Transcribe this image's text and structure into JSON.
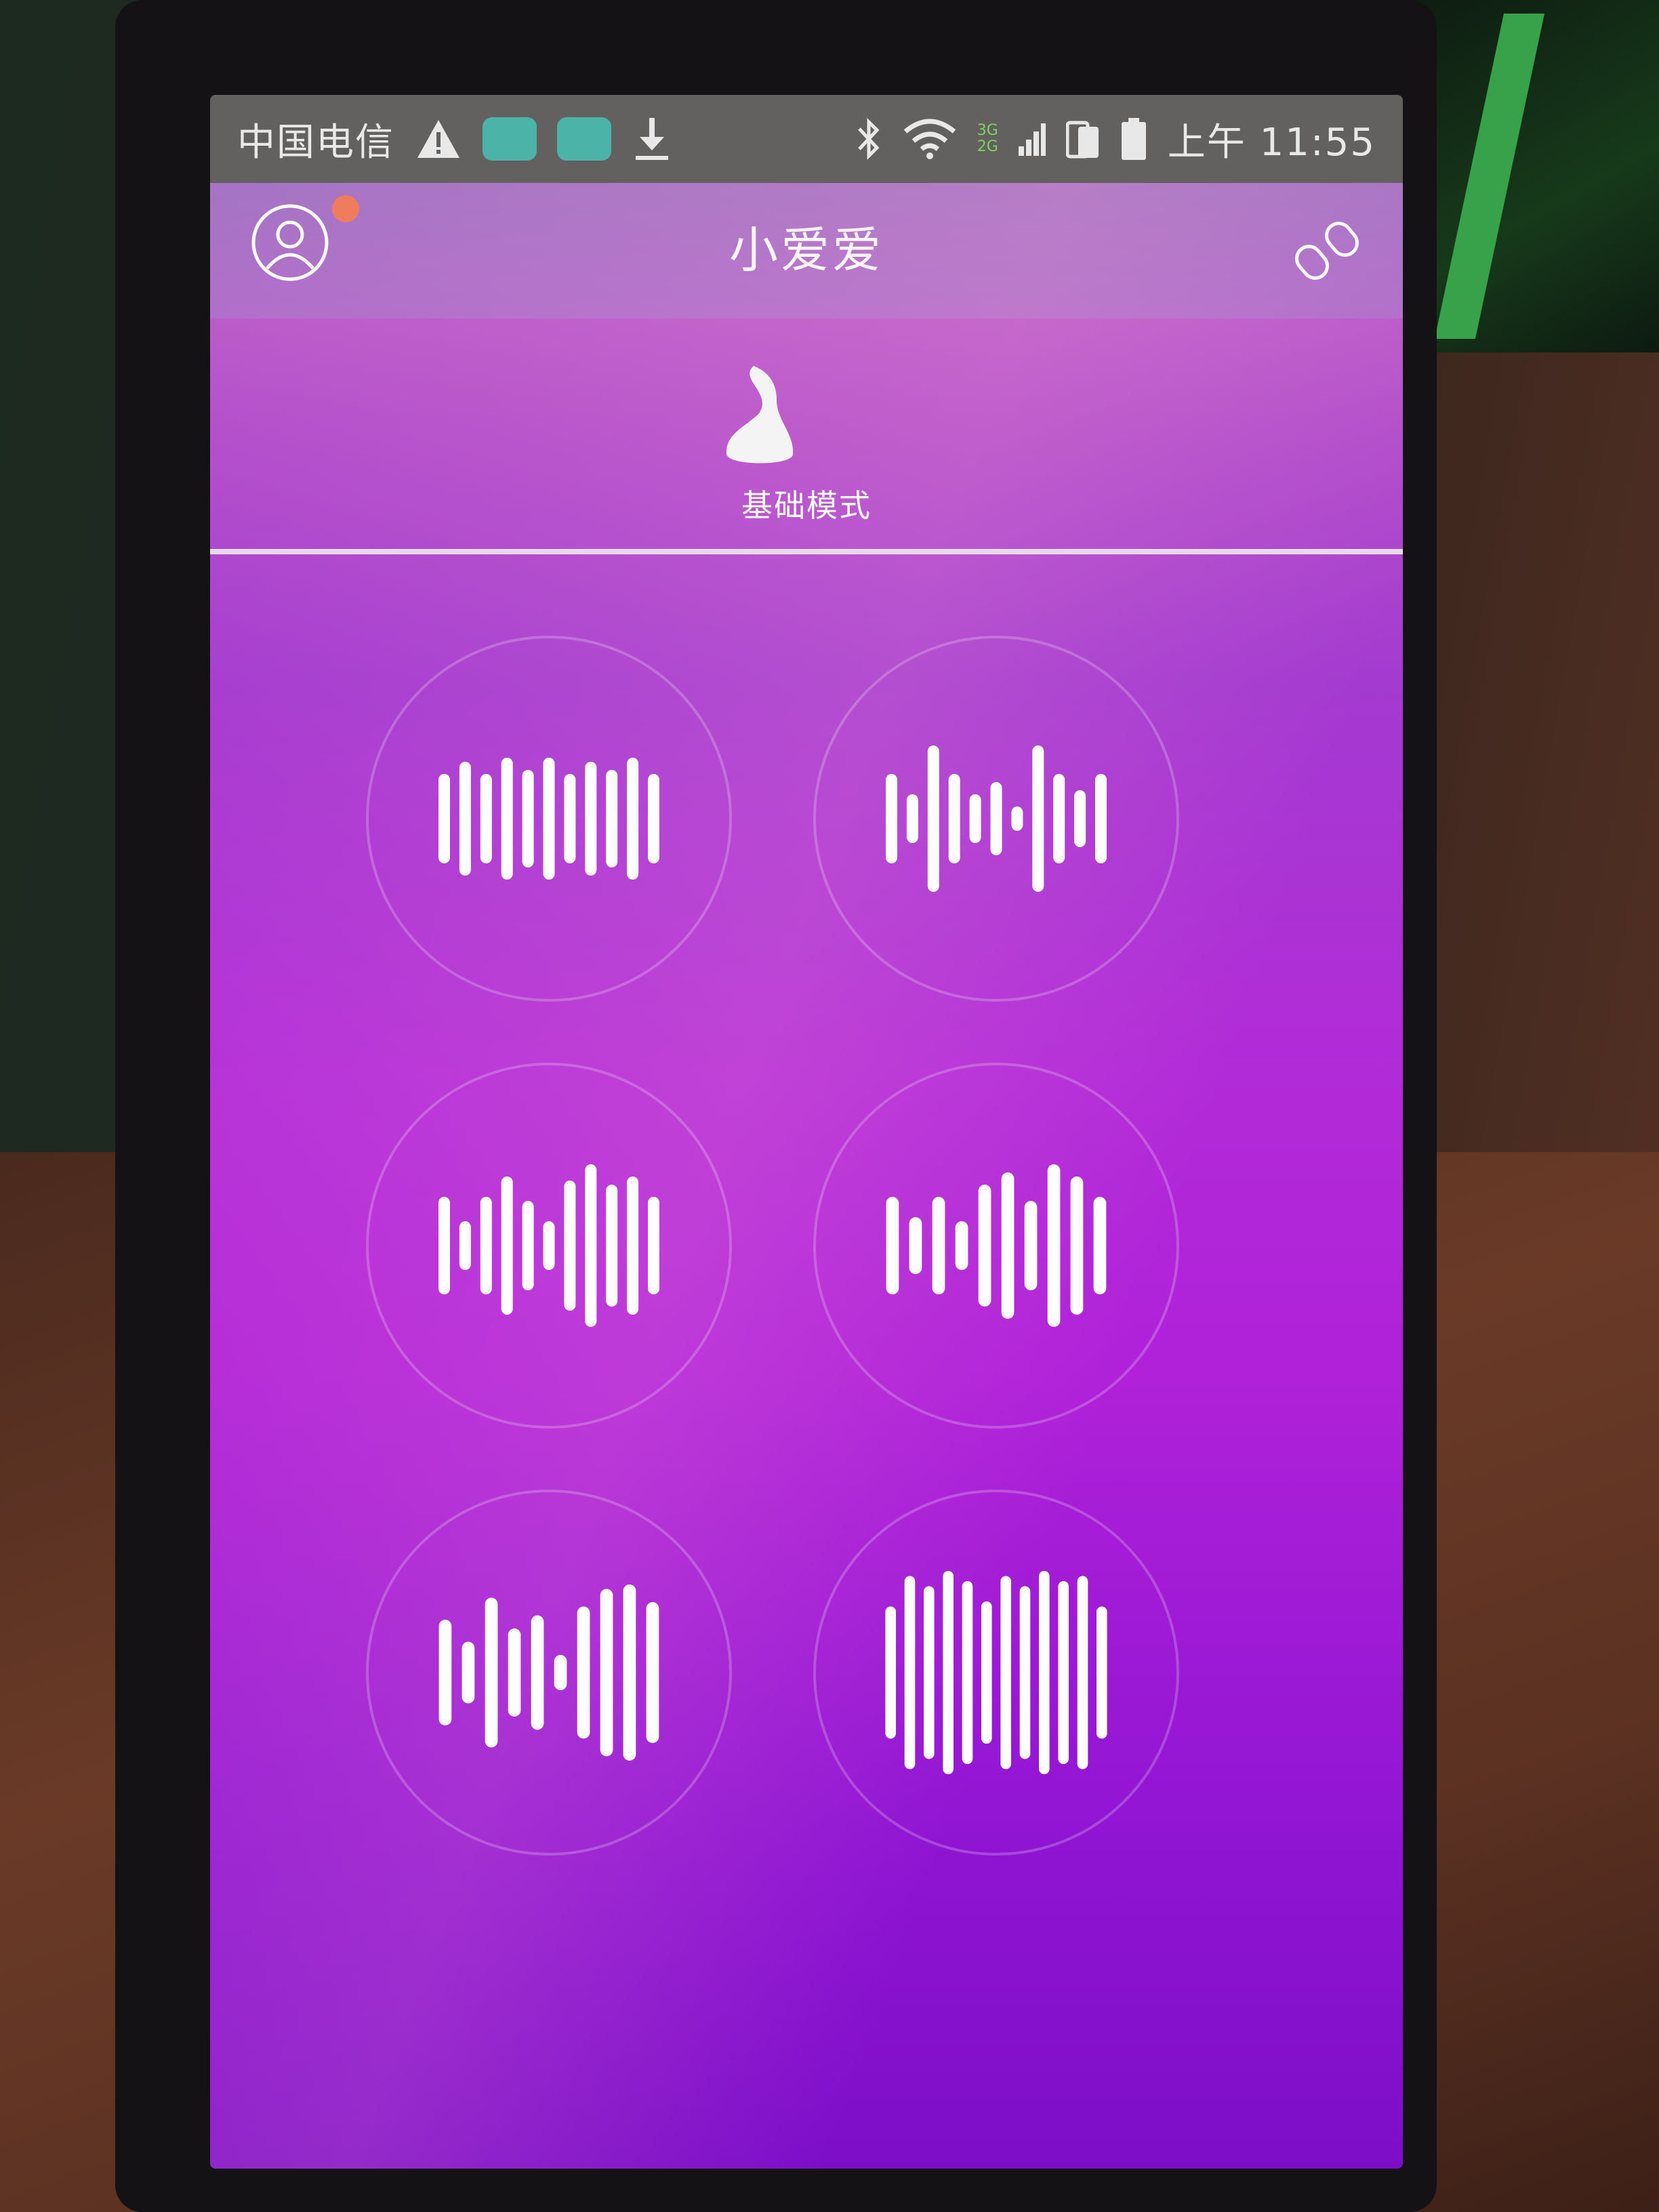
{
  "status_bar": {
    "carrier": "中国电信",
    "network_labels": [
      "3G",
      "2G"
    ],
    "time": "上午 11:55"
  },
  "header": {
    "title": "小爱爱",
    "notification_dot_color": "#f07a5a"
  },
  "mode_tab": {
    "label": "基础模式"
  },
  "colors": {
    "accent_top": "#b06ecb",
    "accent_bottom": "#7d0ec8"
  },
  "patterns": [
    {
      "name": "pattern-1",
      "bars": [
        0.55,
        0.7,
        0.55,
        0.75,
        0.6,
        0.75,
        0.55,
        0.7,
        0.6,
        0.75,
        0.55
      ]
    },
    {
      "name": "pattern-2",
      "bars": [
        0.55,
        0.3,
        0.9,
        0.55,
        0.3,
        0.45,
        0.15,
        0.9,
        0.55,
        0.35,
        0.55
      ]
    },
    {
      "name": "pattern-3",
      "bars": [
        0.6,
        0.3,
        0.6,
        0.85,
        0.55,
        0.3,
        0.8,
        1.0,
        0.75,
        0.85,
        0.6
      ]
    },
    {
      "name": "pattern-4",
      "bars": [
        0.6,
        0.35,
        0.6,
        0.3,
        0.75,
        0.9,
        0.55,
        1.0,
        0.85,
        0.6
      ]
    },
    {
      "name": "pattern-5",
      "bars": [
        0.6,
        0.35,
        0.85,
        0.5,
        0.65,
        0.2,
        0.75,
        0.95,
        1.0,
        0.8
      ]
    },
    {
      "name": "pattern-6",
      "bars": [
        0.65,
        0.95,
        0.85,
        1.0,
        0.9,
        0.7,
        0.95,
        0.85,
        1.0,
        0.9,
        0.95,
        0.65
      ]
    }
  ]
}
